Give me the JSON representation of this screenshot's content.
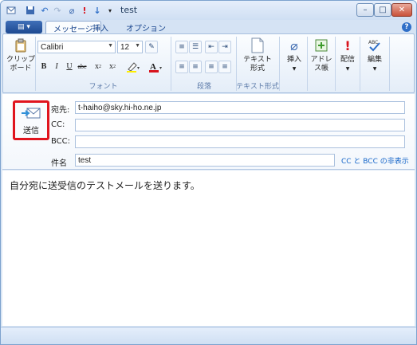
{
  "window": {
    "title": "test"
  },
  "tabs": [
    {
      "label": "メッセージ"
    },
    {
      "label": "挿入"
    },
    {
      "label": "オプション"
    }
  ],
  "ribbon": {
    "clipboard": {
      "label": "クリップ\nボード"
    },
    "font": {
      "family": "Calibri",
      "size": "12",
      "group_label": "フォント"
    },
    "paragraph": {
      "group_label": "段落"
    },
    "text_format": {
      "button_label": "テキスト\n形式",
      "group_label": "テキスト形式"
    },
    "insert": {
      "label": "挿入"
    },
    "address": {
      "label": "アドレ\nス帳"
    },
    "priority": {
      "label": "配信"
    },
    "edit": {
      "label": "編集"
    }
  },
  "header": {
    "send_label": "送信",
    "to_label": "宛先:",
    "to_value": "t-haiho@sky.hi-ho.ne.jp",
    "cc_label": "CC:",
    "cc_value": "",
    "bcc_label": "BCC:",
    "bcc_value": "",
    "subject_label": "件名",
    "subject_value": "test",
    "cc_bcc_link": "CC と BCC の非表示"
  },
  "body": {
    "text": "自分宛に送受信のテストメールを送ります。"
  },
  "colors": {
    "accent": "#1565c8",
    "send_highlight": "#e0141e",
    "brand": "#1e4a91"
  }
}
